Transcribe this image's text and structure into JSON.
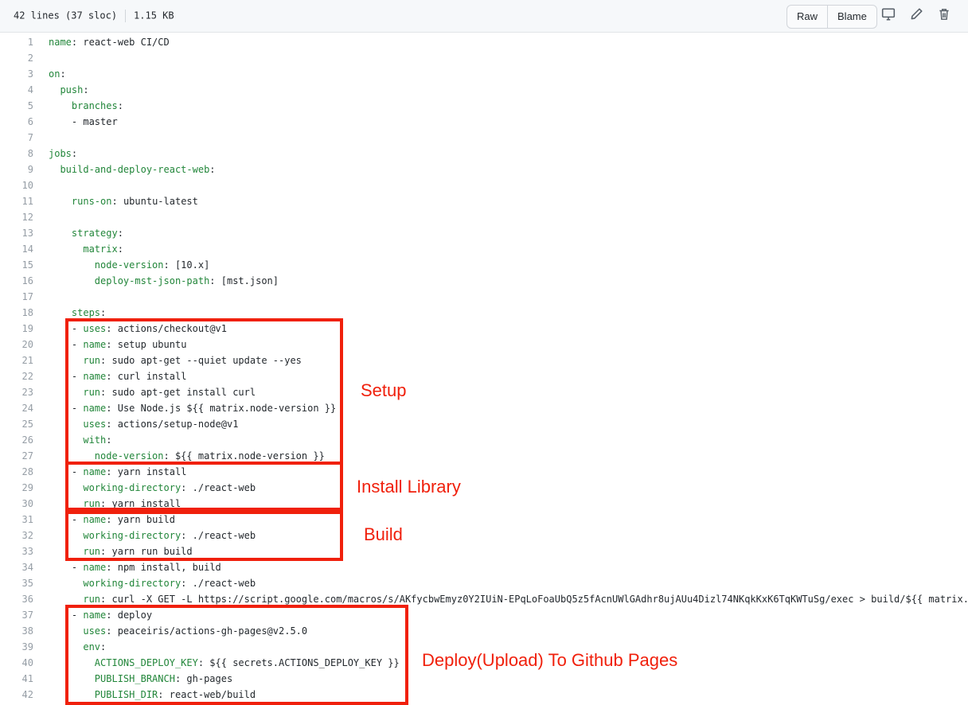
{
  "file_info": {
    "lines": "42 lines (37 sloc)",
    "size": "1.15 KB"
  },
  "toolbar": {
    "raw_label": "Raw",
    "blame_label": "Blame",
    "icons": [
      "desktop-icon",
      "pencil-icon",
      "trash-icon"
    ]
  },
  "code_lines": [
    {
      "n": "1",
      "key": "name",
      "val": " react-web CI/CD"
    },
    {
      "n": "2",
      "key": "",
      "val": ""
    },
    {
      "n": "3",
      "key": "on",
      "val": ""
    },
    {
      "n": "4",
      "key": "  push",
      "val": ""
    },
    {
      "n": "5",
      "key": "    branches",
      "val": ""
    },
    {
      "n": "6",
      "key": "",
      "val": "    - master"
    },
    {
      "n": "7",
      "key": "",
      "val": ""
    },
    {
      "n": "8",
      "key": "jobs",
      "val": ""
    },
    {
      "n": "9",
      "key": "  build-and-deploy-react-web",
      "val": ""
    },
    {
      "n": "10",
      "key": "",
      "val": ""
    },
    {
      "n": "11",
      "key": "    runs-on",
      "val": " ubuntu-latest"
    },
    {
      "n": "12",
      "key": "",
      "val": ""
    },
    {
      "n": "13",
      "key": "    strategy",
      "val": ""
    },
    {
      "n": "14",
      "key": "      matrix",
      "val": ""
    },
    {
      "n": "15",
      "key": "        node-version",
      "val": " [10.x]"
    },
    {
      "n": "16",
      "key": "        deploy-mst-json-path",
      "val": " [mst.json]"
    },
    {
      "n": "17",
      "key": "",
      "val": ""
    },
    {
      "n": "18",
      "key": "    steps",
      "val": ""
    },
    {
      "n": "19",
      "pre": "    - ",
      "key": "uses",
      "val": " actions/checkout@v1"
    },
    {
      "n": "20",
      "pre": "    - ",
      "key": "name",
      "val": " setup ubuntu"
    },
    {
      "n": "21",
      "key": "      run",
      "val": " sudo apt-get --quiet update --yes"
    },
    {
      "n": "22",
      "pre": "    - ",
      "key": "name",
      "val": " curl install"
    },
    {
      "n": "23",
      "key": "      run",
      "val": " sudo apt-get install curl"
    },
    {
      "n": "24",
      "pre": "    - ",
      "key": "name",
      "val": " Use Node.js ${{ matrix.node-version }}"
    },
    {
      "n": "25",
      "key": "      uses",
      "val": " actions/setup-node@v1"
    },
    {
      "n": "26",
      "key": "      with",
      "val": ""
    },
    {
      "n": "27",
      "key": "        node-version",
      "val": " ${{ matrix.node-version }}"
    },
    {
      "n": "28",
      "pre": "    - ",
      "key": "name",
      "val": " yarn install"
    },
    {
      "n": "29",
      "key": "      working-directory",
      "val": " ./react-web"
    },
    {
      "n": "30",
      "key": "      run",
      "val": " yarn install"
    },
    {
      "n": "31",
      "pre": "    - ",
      "key": "name",
      "val": " yarn build"
    },
    {
      "n": "32",
      "key": "      working-directory",
      "val": " ./react-web"
    },
    {
      "n": "33",
      "key": "      run",
      "val": " yarn run build"
    },
    {
      "n": "34",
      "pre": "    - ",
      "key": "name",
      "val": " npm install, build"
    },
    {
      "n": "35",
      "key": "      working-directory",
      "val": " ./react-web"
    },
    {
      "n": "36",
      "key": "      run",
      "val": " curl -X GET -L https://script.google.com/macros/s/AKfycbwEmyz0Y2IUiN-EPqLoFoaUbQ5z5fAcnUWlGAdhr8ujAUu4Dizl74NKqkKxK6TqKWTuSg/exec > build/${{ matrix."
    },
    {
      "n": "37",
      "pre": "    - ",
      "key": "name",
      "val": " deploy"
    },
    {
      "n": "38",
      "key": "      uses",
      "val": " peaceiris/actions-gh-pages@v2.5.0"
    },
    {
      "n": "39",
      "key": "      env",
      "val": ""
    },
    {
      "n": "40",
      "key": "        ACTIONS_DEPLOY_KEY",
      "val": " ${{ secrets.ACTIONS_DEPLOY_KEY }}"
    },
    {
      "n": "41",
      "key": "        PUBLISH_BRANCH",
      "val": " gh-pages"
    },
    {
      "n": "42",
      "key": "        PUBLISH_DIR",
      "val": " react-web/build"
    }
  ],
  "annotations": {
    "setup": "Setup",
    "install": "Install Library",
    "build": "Build",
    "deploy": "Deploy(Upload) To Github Pages"
  },
  "colors": {
    "annotation": "#f0200c",
    "key": "#22863a",
    "line_number": "#959da5"
  }
}
